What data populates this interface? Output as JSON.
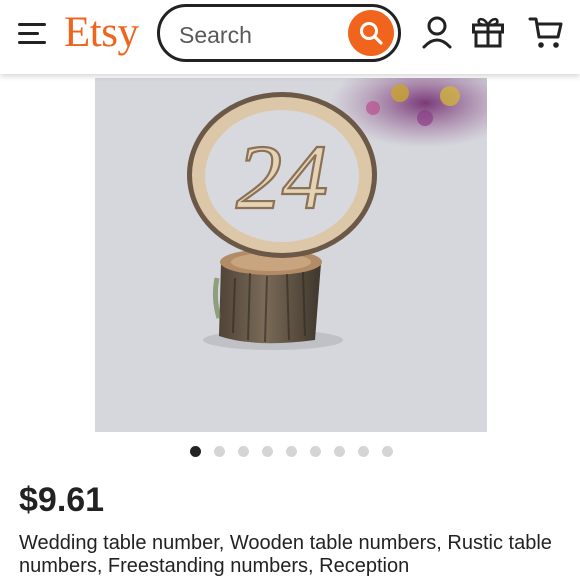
{
  "header": {
    "logo": "Etsy",
    "search": {
      "placeholder": "Search"
    },
    "icons": [
      "menu-icon",
      "search-icon",
      "account-icon",
      "gift-icon",
      "cart-icon"
    ]
  },
  "gallery": {
    "image_count": 9,
    "active_index": 0
  },
  "listing": {
    "price": "$9.61",
    "title": "Wedding table number, Wooden table numbers, Rustic table numbers, Freestanding numbers, Reception"
  },
  "colors": {
    "brand_orange": "#F1641E",
    "text": "#222222",
    "dot_active": "#222222",
    "dot_inactive": "#d5d5d5"
  }
}
